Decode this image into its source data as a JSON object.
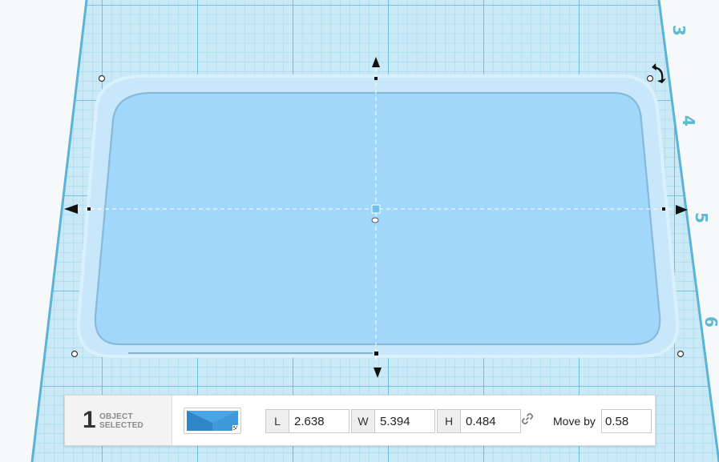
{
  "workplane": {
    "ruler_labels": [
      "3",
      "4",
      "5",
      "6"
    ]
  },
  "toolbar": {
    "selected_count": "1",
    "selected_line1": "OBJECT",
    "selected_line2": "SELECTED",
    "length_label": "L",
    "length_value": "2.638",
    "width_label": "W",
    "width_value": "5.394",
    "height_label": "H",
    "height_value": "0.484",
    "move_by_label": "Move by",
    "move_by_value": "0.58"
  },
  "colors": {
    "grid_background": "#c9e9f6",
    "grid_line": "#7cc8e2",
    "shape_fill": "#a0d7fb",
    "shape_rim": "#c6e7fb",
    "swatch": "#47a6e6"
  },
  "icons": [
    "arrow-up-icon",
    "arrow-down-icon",
    "arrow-left-icon",
    "arrow-right-icon",
    "rotate-icon",
    "link-icon",
    "center-handle-icon"
  ]
}
